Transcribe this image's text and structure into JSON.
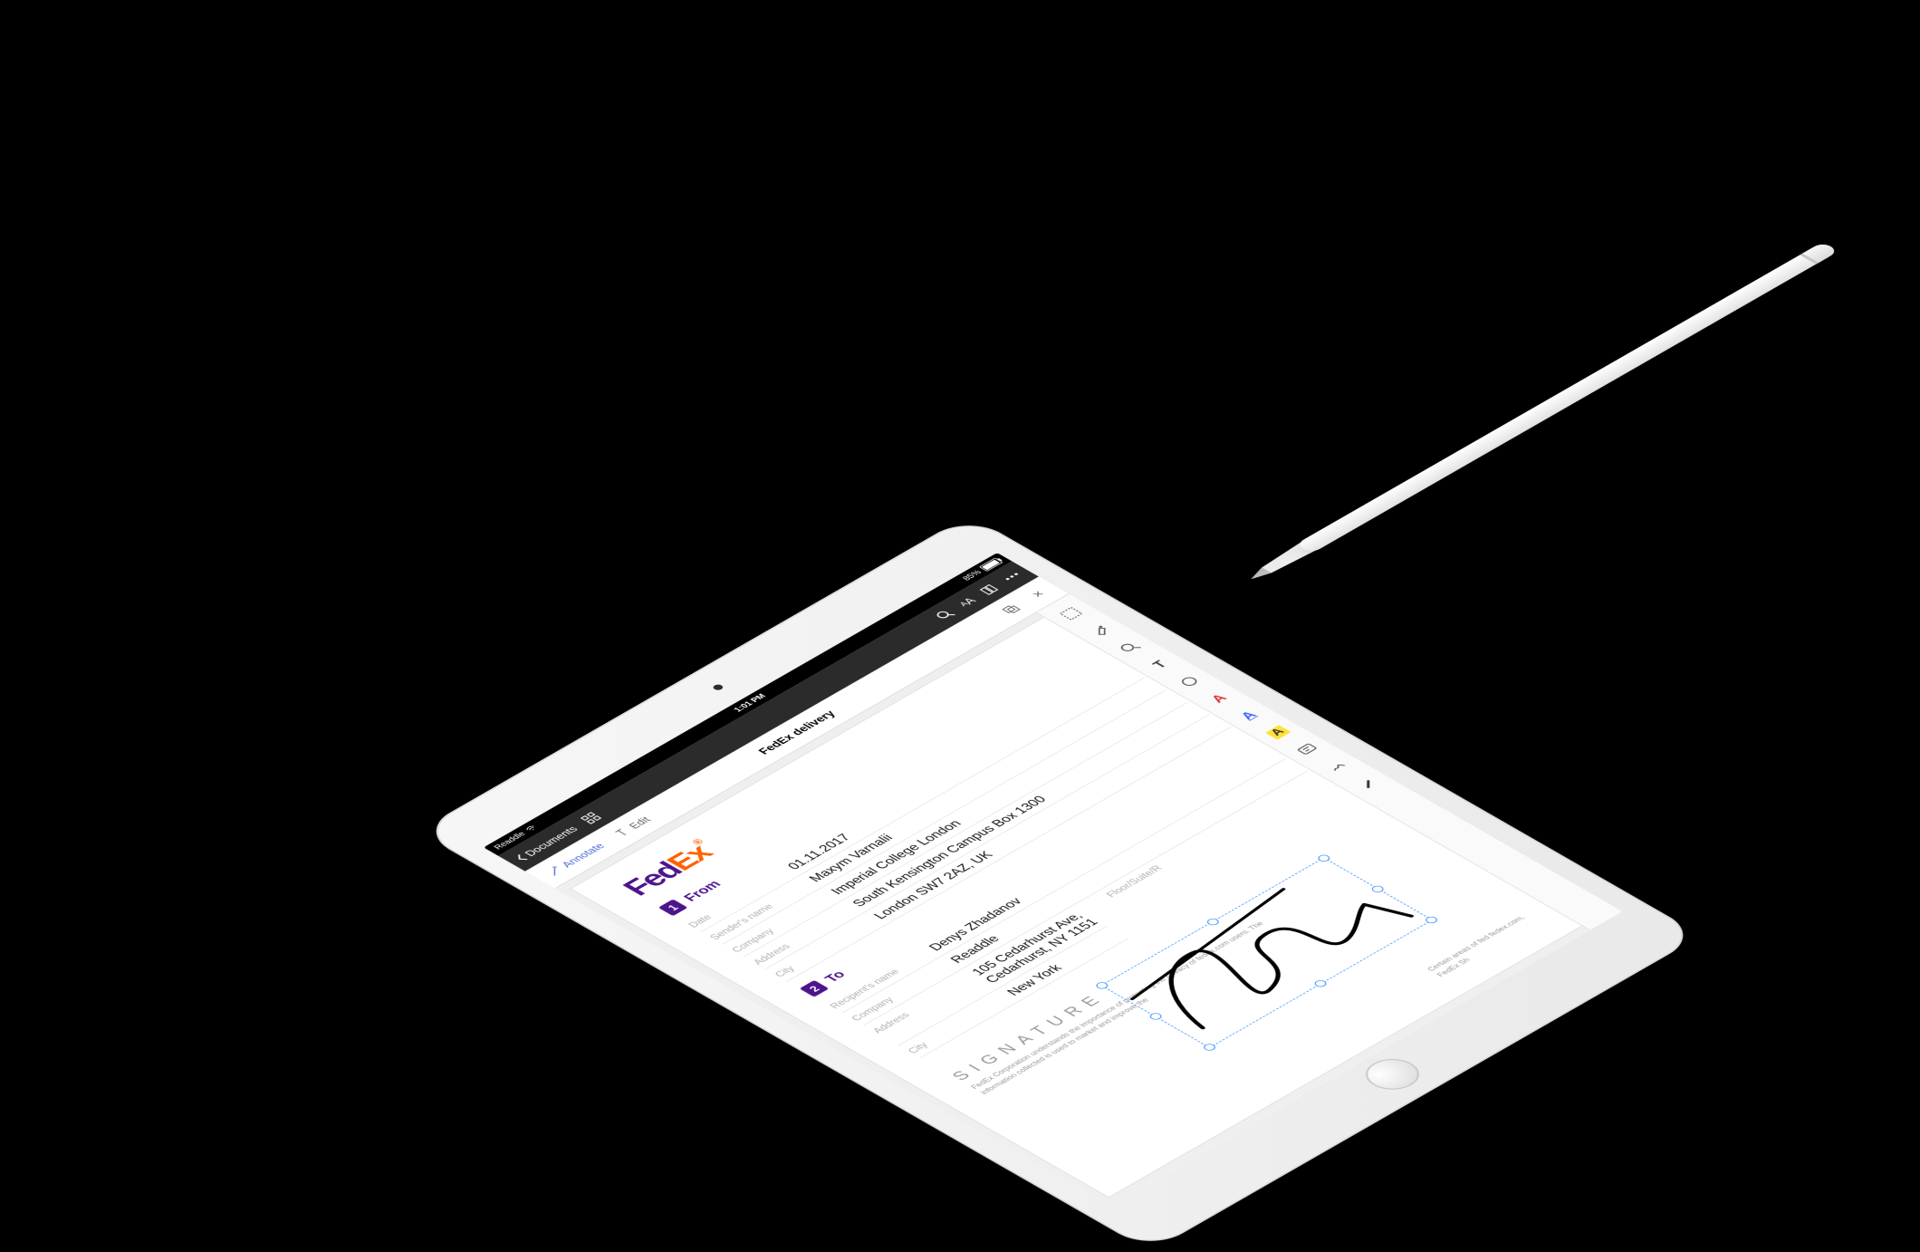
{
  "status": {
    "carrier": "Readdle",
    "time": "1:01 PM",
    "battery_pct": "85%"
  },
  "topnav": {
    "back_label": "Documents"
  },
  "toolbar": {
    "annotate_label": "Annotate",
    "edit_label": "Edit",
    "doc_title": "FedEx delivery",
    "font_label": "AA"
  },
  "logo": {
    "left": "Fed",
    "right": "Ex",
    "reg": "®"
  },
  "section1": {
    "num": "1",
    "label": "From"
  },
  "section2": {
    "num": "2",
    "label": "To"
  },
  "from": {
    "date_label": "Date",
    "date": "01.11.2017",
    "name_label": "Sender's name",
    "name": "Maxym Varnalii",
    "company_label": "Company",
    "company": "Imperial College London",
    "address_label": "Address",
    "address": "South Kensington Campus Box 1300",
    "city_label": "City",
    "city": "London SW7 2AZ, UK"
  },
  "to": {
    "name_label": "Recipent's name",
    "name": "Denys Zhadanov",
    "company_label": "Company",
    "company": "Readdle",
    "address_label": "Address",
    "address": "105 Cedarhurst Ave, Cedarhurst, NY 1151",
    "city_label": "City",
    "city": "New York",
    "floor_label": "Floor/Suite/R"
  },
  "signature_header": "SIGNATURE",
  "legal_left": "FedEx Corporation understands the importance of protecting the privacy of fedex.com users. The information collected is used to market and improve the",
  "legal_right": "Certain areas of fed fedex.com, FedEx Sh",
  "annotools": {
    "select": "select-tool",
    "eraser": "eraser-tool",
    "magnify": "magnifier-tool",
    "text": "T",
    "shape": "shape-tool",
    "textstyle": "A",
    "underline": "A",
    "highlight": "A",
    "note": "note-tool",
    "signature": "signature-tool",
    "marker": "marker-tool"
  }
}
